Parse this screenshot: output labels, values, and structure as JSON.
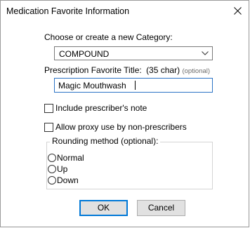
{
  "window": {
    "title": "Medication Favorite Information",
    "close_icon": "close-icon"
  },
  "category": {
    "label": "Choose or create a new Category:",
    "selected": "COMPOUND"
  },
  "favorite_title": {
    "label": "Prescription Favorite Title:",
    "limit": "(35 char)",
    "optional": "(optional)",
    "value": "Magic Mouthwash"
  },
  "options": {
    "include_note_label": "Include prescriber's note",
    "include_note_checked": false,
    "allow_proxy_label": "Allow proxy use by non-prescribers",
    "allow_proxy_checked": false
  },
  "rounding": {
    "label": "Rounding method (optional):",
    "options": [
      "Normal",
      "Up",
      "Down"
    ],
    "selected": null
  },
  "buttons": {
    "ok": "OK",
    "cancel": "Cancel"
  },
  "colors": {
    "focus_border": "#2b73c5",
    "default_button_border": "#0078d7"
  }
}
